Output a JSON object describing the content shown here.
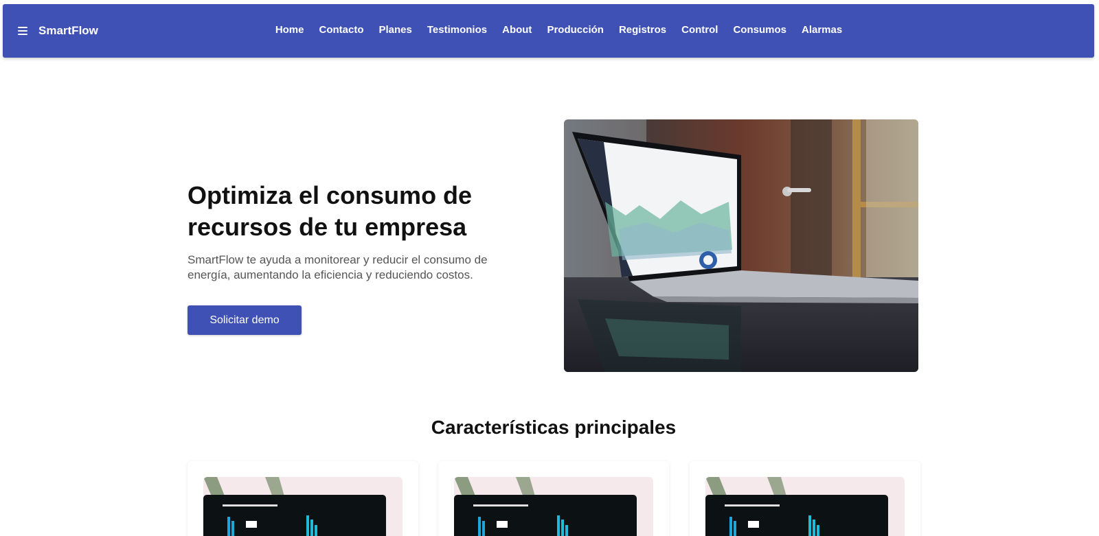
{
  "navbar": {
    "brand": "SmartFlow",
    "menu_icon": "hamburger-menu-icon",
    "links": [
      "Home",
      "Contacto",
      "Planes",
      "Testimonios",
      "About",
      "Producción",
      "Registros",
      "Control",
      "Consumos",
      "Alarmas"
    ]
  },
  "hero": {
    "title": "Optimiza el consumo de recursos de tu empresa",
    "description": "SmartFlow te ayuda a monitorear y reducir el consumo de energía, aumentando la eficiencia y reduciendo costos.",
    "cta_label": "Solicitar demo"
  },
  "features": {
    "title": "Características principales",
    "card_count_visible": 3
  },
  "colors": {
    "primary": "#3f51b5",
    "text": "#111111",
    "muted": "#555555"
  }
}
